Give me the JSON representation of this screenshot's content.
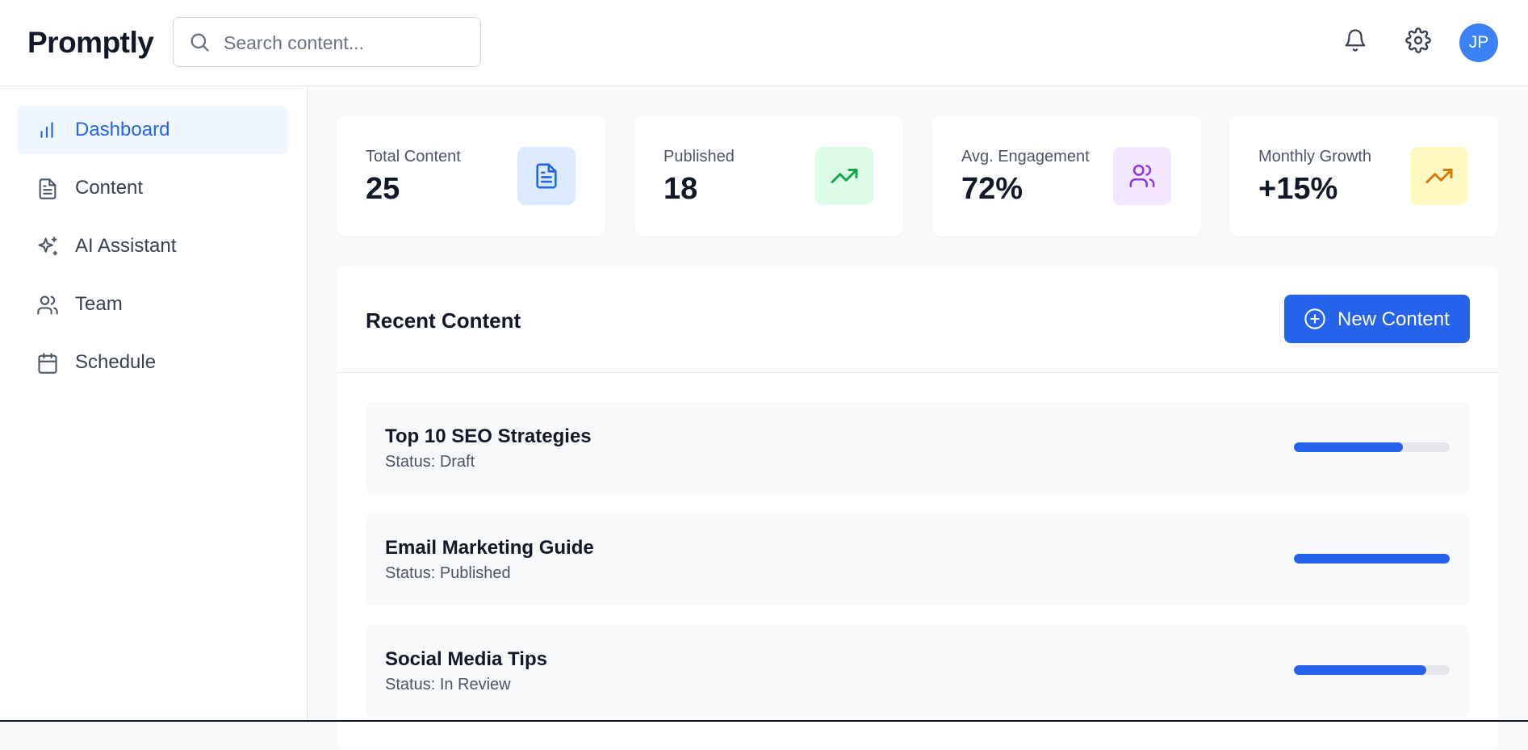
{
  "app": {
    "name": "Promptly"
  },
  "search": {
    "placeholder": "Search content..."
  },
  "user": {
    "initials": "JP"
  },
  "sidebar": {
    "items": [
      {
        "label": "Dashboard",
        "icon": "bar-chart-icon",
        "active": true
      },
      {
        "label": "Content",
        "icon": "document-icon",
        "active": false
      },
      {
        "label": "AI Assistant",
        "icon": "sparkles-icon",
        "active": false
      },
      {
        "label": "Team",
        "icon": "users-icon",
        "active": false
      },
      {
        "label": "Schedule",
        "icon": "calendar-icon",
        "active": false
      }
    ]
  },
  "stats": [
    {
      "label": "Total Content",
      "value": "25",
      "icon": "document-icon",
      "icon_bg": "#dbeafe",
      "icon_color": "#2563eb"
    },
    {
      "label": "Published",
      "value": "18",
      "icon": "trending-up-icon",
      "icon_bg": "#dcfce7",
      "icon_color": "#16a34a"
    },
    {
      "label": "Avg. Engagement",
      "value": "72%",
      "icon": "users-icon",
      "icon_bg": "#f3e8ff",
      "icon_color": "#9333ea"
    },
    {
      "label": "Monthly Growth",
      "value": "+15%",
      "icon": "trending-up-icon",
      "icon_bg": "#fef9c3",
      "icon_color": "#d97706"
    }
  ],
  "recent": {
    "title": "Recent Content",
    "new_button": "New Content",
    "status_prefix": "Status: ",
    "items": [
      {
        "title": "Top 10 SEO Strategies",
        "status": "Draft",
        "progress": 0.7
      },
      {
        "title": "Email Marketing Guide",
        "status": "Published",
        "progress": 1.0
      },
      {
        "title": "Social Media Tips",
        "status": "In Review",
        "progress": 0.85
      }
    ]
  },
  "colors": {
    "accent": "#2563eb",
    "active_nav_bg": "#eff6ff"
  }
}
